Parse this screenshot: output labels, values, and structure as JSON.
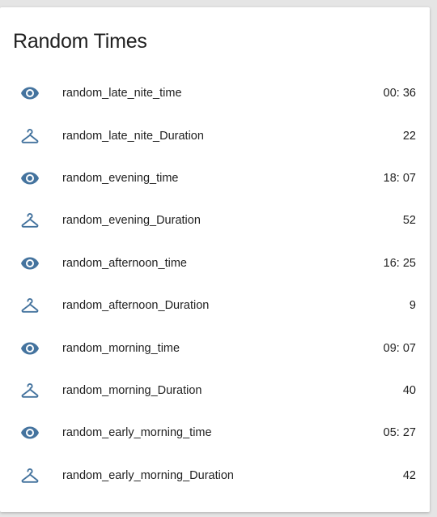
{
  "card": {
    "title": "Random Times"
  },
  "colors": {
    "icon": "#44739e",
    "text": "#212121",
    "card_bg": "#ffffff",
    "page_bg": "#e5e5e5"
  },
  "rows": [
    {
      "icon": "eye-icon",
      "name": "random_late_nite_time",
      "value": "00: 36"
    },
    {
      "icon": "hanger-icon",
      "name": "random_late_nite_Duration",
      "value": "22"
    },
    {
      "icon": "eye-icon",
      "name": "random_evening_time",
      "value": "18: 07"
    },
    {
      "icon": "hanger-icon",
      "name": "random_evening_Duration",
      "value": "52"
    },
    {
      "icon": "eye-icon",
      "name": "random_afternoon_time",
      "value": "16: 25"
    },
    {
      "icon": "hanger-icon",
      "name": "random_afternoon_Duration",
      "value": "9"
    },
    {
      "icon": "eye-icon",
      "name": "random_morning_time",
      "value": "09: 07"
    },
    {
      "icon": "hanger-icon",
      "name": "random_morning_Duration",
      "value": "40"
    },
    {
      "icon": "eye-icon",
      "name": "random_early_morning_time",
      "value": "05: 27"
    },
    {
      "icon": "hanger-icon",
      "name": "random_early_morning_Duration",
      "value": "42"
    }
  ]
}
